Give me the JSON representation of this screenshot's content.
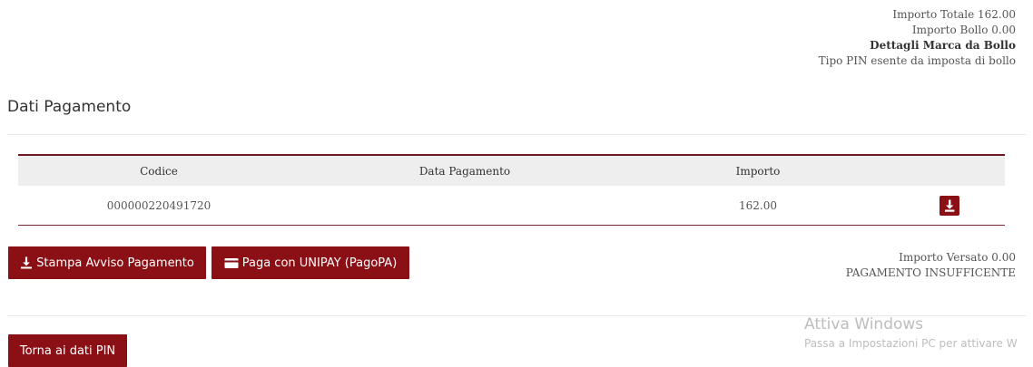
{
  "totals": {
    "importo_totale": "Importo Totale 162.00",
    "importo_bollo": "Importo Bollo 0.00",
    "dettagli_marca": "Dettagli Marca da Bollo",
    "tipo_pin": "Tipo PIN esente da imposta di bollo"
  },
  "section": {
    "title": "Dati Pagamento"
  },
  "table": {
    "headers": [
      "Codice",
      "Data Pagamento",
      "Importo",
      ""
    ],
    "rows": [
      {
        "codice": "000000220491720",
        "data_pagamento": "",
        "importo": "162.00",
        "action_icon": "download-icon"
      }
    ]
  },
  "actions": {
    "stampa_label": "Stampa Avviso Pagamento",
    "stampa_icon": "download-icon",
    "paga_label": "Paga con UNIPAY (PagoPA)",
    "paga_icon": "credit-card-icon",
    "torna_label": "Torna ai dati PIN"
  },
  "status": {
    "importo_versato": "Importo Versato 0.00",
    "esito": "PAGAMENTO INSUFFICENTE"
  },
  "watermark": {
    "title": "Attiva Windows",
    "subtitle": "Passa a Impostazioni PC per attivare W"
  },
  "colors": {
    "accent": "#8b1016",
    "table_border": "#6b1a23",
    "header_bg": "#eeeeee",
    "text": "#555555"
  }
}
